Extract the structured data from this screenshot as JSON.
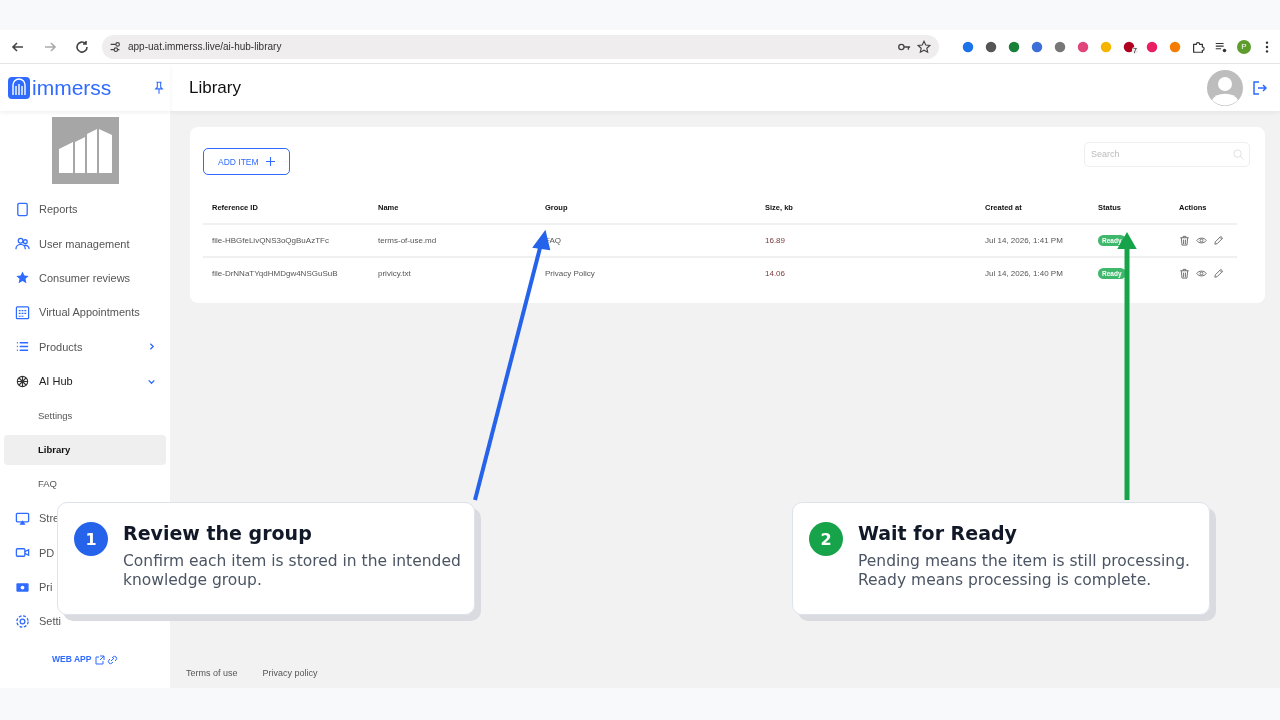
{
  "browser": {
    "url": "app-uat.immerss.live/ai-hub-library",
    "extension_badge": "7",
    "profile_initial": "P"
  },
  "sidebar": {
    "logo": "immerss",
    "items": [
      {
        "label": "Reports",
        "kind": "nav",
        "selected": false
      },
      {
        "label": "User management",
        "kind": "nav",
        "selected": false
      },
      {
        "label": "Consumer reviews",
        "kind": "nav",
        "selected": false
      },
      {
        "label": "Virtual Appointments",
        "kind": "nav",
        "selected": false
      },
      {
        "label": "Products",
        "kind": "nav",
        "selected": false,
        "expanded": false
      },
      {
        "label": "AI Hub",
        "kind": "nav",
        "selected": false,
        "expanded": true
      },
      {
        "label": "Settings",
        "kind": "sub",
        "selected": false
      },
      {
        "label": "Library",
        "kind": "sub",
        "selected": true
      },
      {
        "label": "FAQ",
        "kind": "sub",
        "selected": false
      },
      {
        "label": "Stre",
        "kind": "nav",
        "selected": false
      },
      {
        "label": "PD",
        "kind": "nav",
        "selected": false
      },
      {
        "label": "Pri",
        "kind": "nav",
        "selected": false
      },
      {
        "label": "Setti",
        "kind": "nav",
        "selected": false
      }
    ],
    "web_app_link": "WEB APP"
  },
  "header": {
    "title": "Library"
  },
  "toolbar": {
    "add_button": "ADD ITEM",
    "search": {
      "placeholder": "Search"
    }
  },
  "table": {
    "columns": [
      "Reference ID",
      "Name",
      "Group",
      "Size, kb",
      "Created at",
      "Status",
      "Actions"
    ],
    "rows": [
      {
        "reference_id": "file-HBGfeLivQNS3oQgBuAzTFc",
        "name": "terms-of-use.md",
        "group": "FAQ",
        "size": "16.89",
        "created_at": "Jul 14, 2026, 1:41 PM",
        "status": "Ready"
      },
      {
        "reference_id": "file-DrNNaTYqdHMDgw4NSGuSuB",
        "name": "privicy.txt",
        "group": "Privacy Policy",
        "size": "14.06",
        "created_at": "Jul 14, 2026, 1:40 PM",
        "status": "Ready"
      }
    ]
  },
  "footer": {
    "links": [
      "Terms of use",
      "Privacy policy"
    ]
  },
  "callouts": [
    {
      "number": "1",
      "title": "Review the group",
      "body": "Confirm each item is stored in the intended knowledge group.",
      "color": "#2563eb"
    },
    {
      "number": "2",
      "title": "Wait for Ready",
      "body": "Pending means the item is still processing. Ready means processing is complete.",
      "color": "#16a34a"
    }
  ]
}
